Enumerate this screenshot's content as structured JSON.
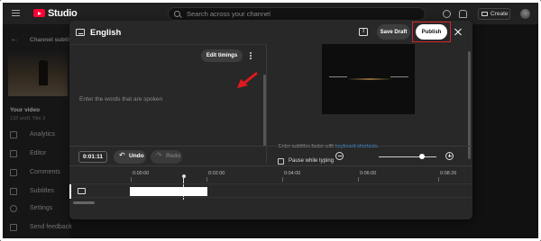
{
  "topbar": {
    "logo_text": "Studio",
    "search_placeholder": "Search across your channel",
    "create_label": "Create"
  },
  "sidebar": {
    "channel_subtitles": "Channel subtitles",
    "your_video": "Your video",
    "video_subtitle": "133 and1 Title 3",
    "items": [
      {
        "label": "Analytics",
        "icon": "analytics-icon"
      },
      {
        "label": "Editor",
        "icon": "editor-icon"
      },
      {
        "label": "Comments",
        "icon": "comments-icon"
      },
      {
        "label": "Subtitles",
        "icon": "subtitles-icon"
      },
      {
        "label": "Settings",
        "icon": "settings-icon"
      },
      {
        "label": "Send feedback",
        "icon": "feedback-icon"
      }
    ]
  },
  "modal": {
    "title": "English",
    "save_draft_label": "Save Draft",
    "publish_label": "Publish",
    "edit_timings_label": "Edit timings",
    "editor_placeholder": "Enter the words that are spoken",
    "kbd_prefix": "Enter subtitles faster with ",
    "kbd_link": "keyboard shortcuts",
    "kbd_suffix": ".",
    "pause_while_typing": "Pause while typing",
    "current_time": "0:01:11",
    "undo_label": "Undo",
    "redo_label": "Redo",
    "zoom_level_fraction": 0.75,
    "timeline_ticks": [
      "0:00:00",
      "0:02:00",
      "0:04:00",
      "0:06:00",
      "0:08:26"
    ]
  },
  "colors": {
    "accent_red": "#d6252b",
    "link_blue": "#3ea6ff",
    "brand_red": "#ff0033"
  }
}
